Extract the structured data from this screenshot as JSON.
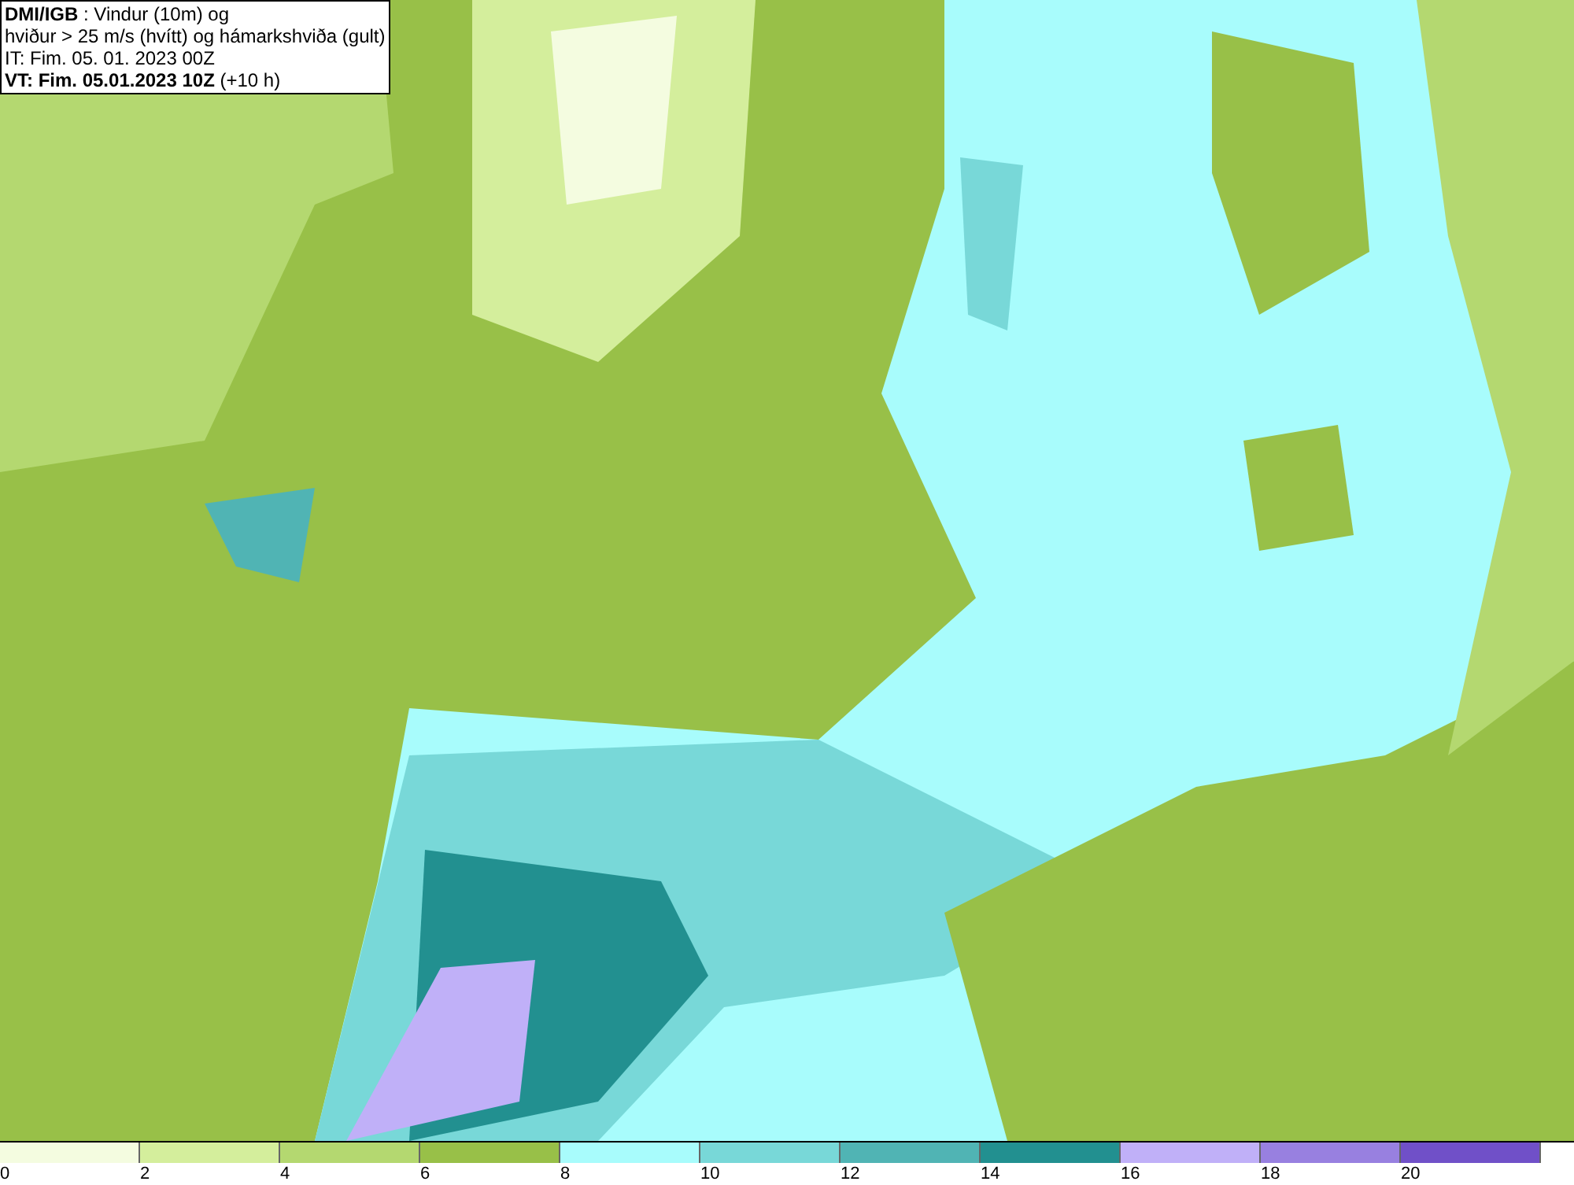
{
  "info_box": {
    "lines": [
      "**DMI/IGB** : Vindur (10m) og",
      "hviður > 25 m/s (hvítt) og hámarkshviða (gult)",
      "IT: Fim. 05. 01. 2023 00Z",
      "**VT: Fim. 05.01.2023 10Z** (+10 h)"
    ]
  },
  "legend": {
    "segments": [
      {
        "label": "0",
        "color": "#f4fce0"
      },
      {
        "label": "2",
        "color": "#d4ee9c"
      },
      {
        "label": "4",
        "color": "#b4d870"
      },
      {
        "label": "6",
        "color": "#98c048"
      },
      {
        "label": "8",
        "color": "#a8fcfc"
      },
      {
        "label": "10",
        "color": "#78d8d8"
      },
      {
        "label": "12",
        "color": "#50b4b4"
      },
      {
        "label": "14",
        "color": "#229090"
      },
      {
        "label": "16",
        "color": "#c0b0f8"
      },
      {
        "label": "18",
        "color": "#9880e0"
      },
      {
        "label": "20",
        "color": "#7050c8"
      }
    ]
  }
}
